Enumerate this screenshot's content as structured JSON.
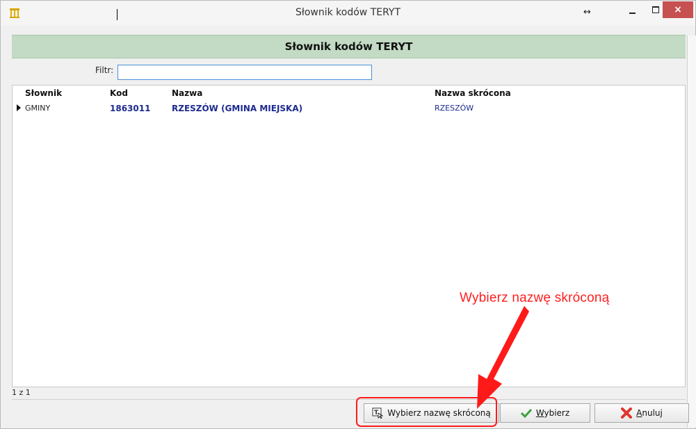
{
  "window": {
    "title": "Słownik kodów TERYT",
    "close_label": "×",
    "resize_label": "↔"
  },
  "header": {
    "title": "Słownik kodów TERYT"
  },
  "filter": {
    "label": "Filtr:",
    "value": ""
  },
  "grid": {
    "columns": [
      "Słownik",
      "Kod",
      "Nazwa",
      "Nazwa skrócona"
    ],
    "rows": [
      {
        "slownik": "GMINY",
        "kod": "1863011",
        "nazwa": "RZESZÓW (GMINA MIEJSKA)",
        "nazwa_skrocona": "RZESZÓW"
      }
    ]
  },
  "status": {
    "text": "1 z 1"
  },
  "buttons": {
    "short_name": "Wybierz nazwę skróconą",
    "ok_underlined": "W",
    "ok_rest": "ybierz",
    "cancel_underlined": "A",
    "cancel_rest": "nuluj"
  },
  "annotation": {
    "text": "Wybierz nazwę skróconą",
    "color": "#ff2020"
  },
  "colors": {
    "header_band": "#c3dbc4",
    "value_text": "#1d2a8e",
    "close_button": "#c75050"
  }
}
